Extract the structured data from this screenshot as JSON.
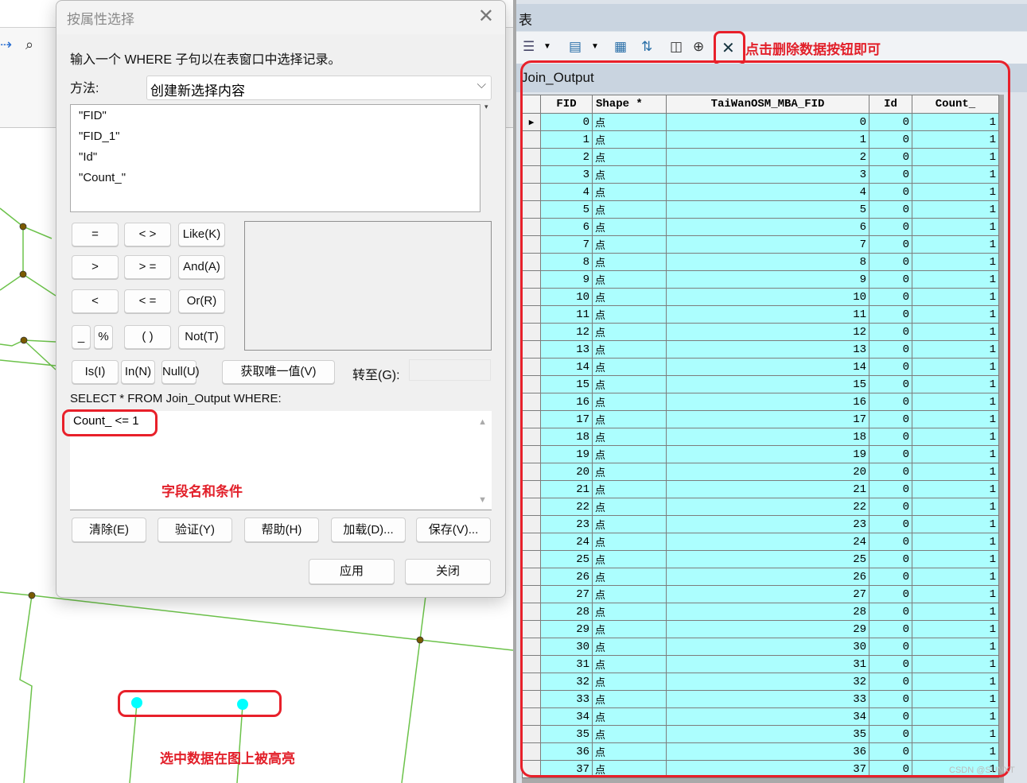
{
  "dialog": {
    "title": "按属性选择",
    "instruction": "输入一个 WHERE 子句以在表窗口中选择记录。",
    "method_label": "方法:",
    "method_value": "创建新选择内容",
    "fields": [
      "\"FID\"",
      "\"FID_1\"",
      "\"Id\"",
      "\"Count_\""
    ],
    "operator_buttons": [
      "=",
      "< >",
      "Like(K)",
      ">",
      "> =",
      "And(A)",
      "<",
      "< =",
      "Or(R)",
      "_",
      "%",
      "( )",
      "Not(T)"
    ],
    "is_button": "Is(I)",
    "in_button": "In(N)",
    "null_button": "Null(U)",
    "unique_values_button": "获取唯一值(V)",
    "goto_label": "转至(G):",
    "goto_value": "",
    "select_prefix": "SELECT * FROM Join_Output WHERE:",
    "where_clause": "Count_ <= 1",
    "bottom_buttons": [
      "清除(E)",
      "验证(Y)",
      "帮助(H)",
      "加载(D)...",
      "保存(V)..."
    ],
    "apply_button": "应用",
    "close_button": "关闭"
  },
  "annotations": {
    "where_note": "字段名和条件",
    "delete_note": "点击删除数据按钮即可",
    "map_note": "选中数据在图上被高亮"
  },
  "table_window": {
    "title": "表",
    "tab_name": "Join_Output",
    "columns": [
      "FID",
      "Shape *",
      "TaiWanOSM_MBA_FID",
      "Id",
      "Count_"
    ],
    "shape_value": "点",
    "id_value": "0",
    "count_value": "1",
    "rows": [
      0,
      1,
      2,
      3,
      4,
      5,
      6,
      7,
      8,
      9,
      10,
      11,
      12,
      13,
      14,
      15,
      16,
      17,
      18,
      19,
      20,
      21,
      22,
      23,
      24,
      25,
      26,
      27,
      28,
      29,
      30,
      31,
      32,
      33,
      34,
      35,
      36,
      37
    ]
  },
  "colors": {
    "selection_highlight": "#00ffff",
    "table_row_bg": "#acfefe",
    "annotation_red": "#e2202a",
    "road_line": "#6cc24a",
    "node_fill": "#7a5a00"
  },
  "watermark": "CSDN @SUNXT"
}
